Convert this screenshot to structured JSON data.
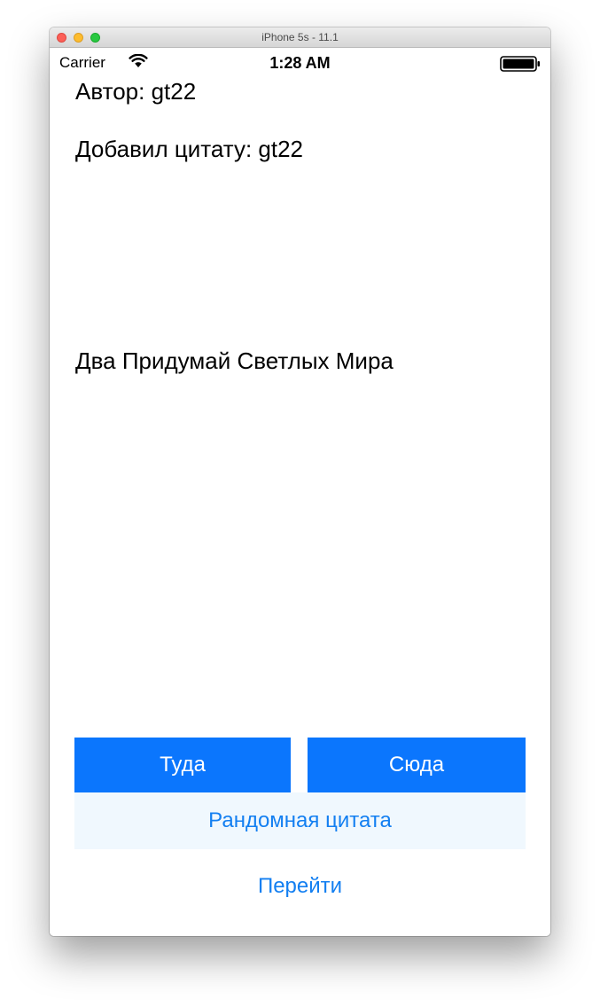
{
  "window": {
    "title": "iPhone 5s - 11.1"
  },
  "status_bar": {
    "carrier": "Carrier",
    "time": "1:28 AM",
    "wifi_icon": "wifi-icon",
    "battery_icon": "battery-icon"
  },
  "quote": {
    "author_label": "Автор: gt22",
    "added_by_label": "Добавил цитату: gt22",
    "text": "Два Придумай Светлых Мира"
  },
  "buttons": {
    "back_label": "Туда",
    "forward_label": "Сюда",
    "random_label": "Рандомная цитата",
    "go_label": "Перейти"
  },
  "colors": {
    "accent": "#0b76fd",
    "link": "#137ff1",
    "random_button_bg": "#f0f8fe"
  }
}
